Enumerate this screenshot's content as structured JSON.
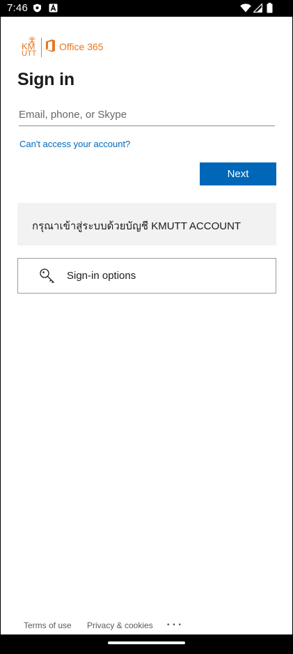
{
  "status_bar": {
    "time": "7:46",
    "left_icons": [
      "shield-icon",
      "a-icon"
    ],
    "right_icons": [
      "wifi-icon",
      "signal-icon",
      "battery-icon"
    ]
  },
  "logo": {
    "brand_kmutt_line1": "KM",
    "brand_kmutt_line2": "UTT",
    "product": "Office 365",
    "accent_color": "#e87722"
  },
  "page": {
    "title": "Sign in"
  },
  "form": {
    "email_placeholder": "Email, phone, or Skype",
    "email_value": "",
    "cant_access_link": "Can't access your account?",
    "next_button": "Next",
    "primary_color": "#0067b8"
  },
  "banner": {
    "text": "กรุณาเข้าสู่ระบบด้วยบัญชี KMUTT ACCOUNT"
  },
  "signin_options": {
    "label": "Sign-in options",
    "icon": "key-icon"
  },
  "footer": {
    "terms": "Terms of use",
    "privacy": "Privacy & cookies",
    "more": "• • •"
  }
}
